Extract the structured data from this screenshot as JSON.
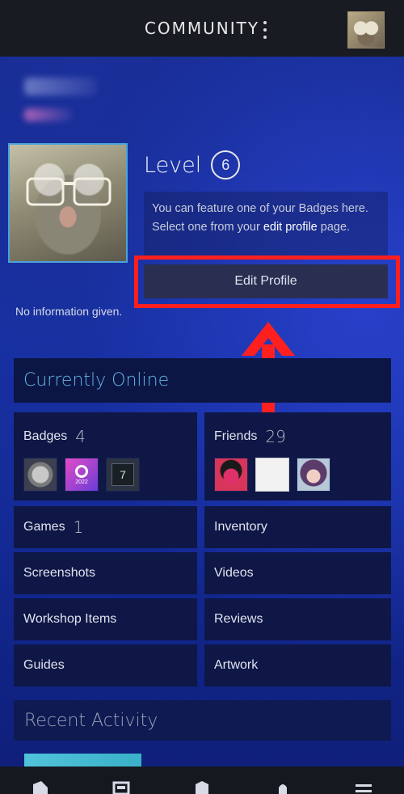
{
  "header": {
    "title": "COMMUNITY"
  },
  "profile": {
    "level_label": "Level",
    "level_value": "6",
    "badge_note_prefix": "You can feature one of your Badges here. Select one from your ",
    "badge_note_link": "edit profile",
    "badge_note_suffix": " page.",
    "edit_profile_label": "Edit Profile",
    "summary": "No information given."
  },
  "status": {
    "label": "Currently Online"
  },
  "tiles": {
    "badges": {
      "label": "Badges",
      "count": "4"
    },
    "friends": {
      "label": "Friends",
      "count": "29"
    },
    "games": {
      "label": "Games",
      "count": "1"
    },
    "inventory": {
      "label": "Inventory"
    },
    "screenshots": {
      "label": "Screenshots"
    },
    "videos": {
      "label": "Videos"
    },
    "workshop": {
      "label": "Workshop Items"
    },
    "reviews": {
      "label": "Reviews"
    },
    "guides": {
      "label": "Guides"
    },
    "artwork": {
      "label": "Artwork"
    }
  },
  "badge_icons": {
    "items": [
      {
        "icon": "silver-coin-badge-icon"
      },
      {
        "icon": "steam-2022-badge-icon",
        "text": "2022"
      },
      {
        "icon": "years-of-service-badge-icon",
        "text": "7"
      }
    ]
  },
  "friend_icons": [
    "friend-avatar-icon",
    "friend-avatar-icon",
    "friend-avatar-icon"
  ],
  "recent": {
    "label": "Recent Activity"
  },
  "colors": {
    "accent_blue": "#5fb5e2",
    "highlight_red": "#ff1f1f",
    "tile_bg": "#0e1746"
  }
}
